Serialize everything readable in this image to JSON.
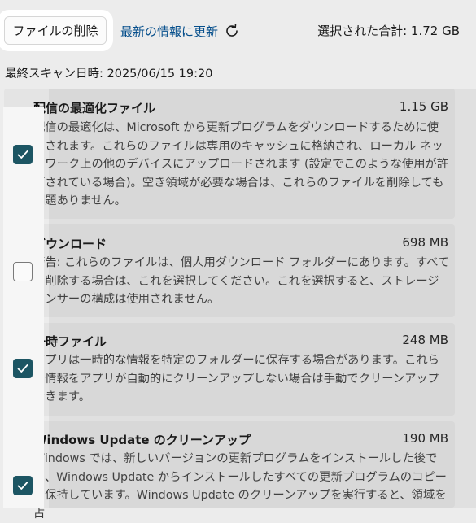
{
  "toolbar": {
    "delete_label": "ファイルの削除",
    "refresh_label": "最新の情報に更新",
    "refresh_icon": "refresh-icon",
    "total_label": "選択された合計: 1.72 GB"
  },
  "last_scan": "最終スキャン日時: 2025/06/15 19:20",
  "items": [
    {
      "title": "配信の最適化ファイル",
      "size": "1.15 GB",
      "checked": true,
      "description": "配信の最適化は、Microsoft から更新プログラムをダウンロードするために使用されます。これらのファイルは専用のキャッシュに格納され、ローカル ネットワーク上の他のデバイスにアップロードされます (設定でこのような使用が許可されている場合)。空き領域が必要な場合は、これらのファイルを削除しても問題ありません。"
    },
    {
      "title": "ダウンロード",
      "size": "698 MB",
      "checked": false,
      "description": "警告: これらのファイルは、個人用ダウンロード フォルダーにあります。すべてを削除する場合は、これを選択してください。これを選択すると、ストレージ センサーの構成は使用されません。"
    },
    {
      "title": "一時ファイル",
      "size": "248 MB",
      "checked": true,
      "description": "アプリは一時的な情報を特定のフォルダーに保存する場合があります。これらの情報をアプリが自動的にクリーンアップしない場合は手動でクリーンアップできます。"
    },
    {
      "title": "Windows Update のクリーンアップ",
      "size": "190 MB",
      "checked": true,
      "description": "Windows では、新しいバージョンの更新プログラムをインストールした後でも、Windows Update からインストールしたすべての更新プログラムのコピーを保持しています。Windows Update のクリーンアップを実行すると、領域を占"
    }
  ]
}
